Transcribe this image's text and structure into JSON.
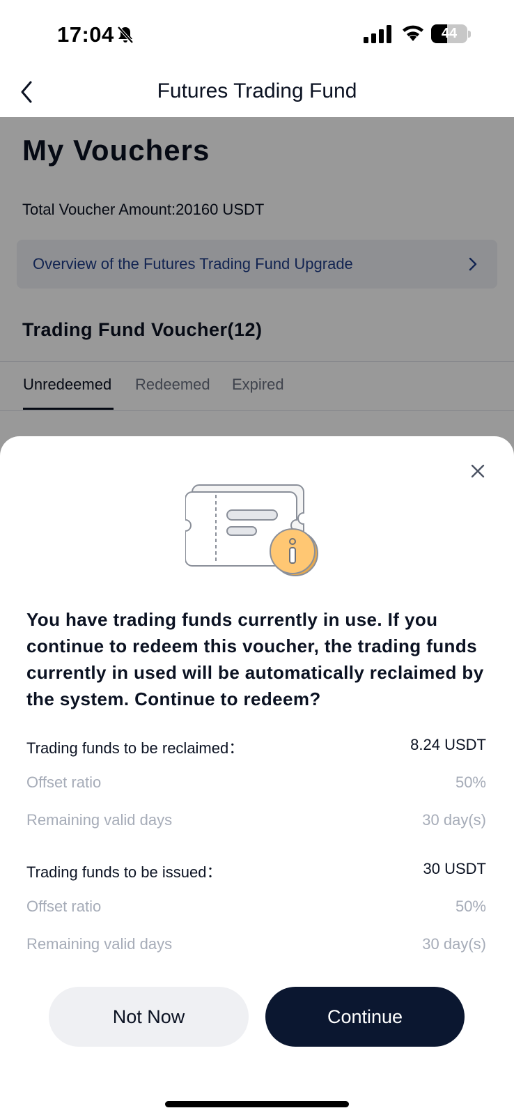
{
  "status_bar": {
    "time": "17:04",
    "battery_level": "44",
    "battery_fraction": 0.44
  },
  "nav": {
    "title": "Futures Trading Fund",
    "back_icon": "chevron-left-icon"
  },
  "page": {
    "title": "My Vouchers",
    "total_amount": "Total Voucher Amount:20160 USDT",
    "overview_link": "Overview of the Futures Trading Fund Upgrade",
    "section_title": "Trading Fund Voucher(12)",
    "tabs": [
      {
        "label": "Unredeemed",
        "active": true
      },
      {
        "label": "Redeemed",
        "active": false
      },
      {
        "label": "Expired",
        "active": false
      }
    ]
  },
  "sheet": {
    "illustration": "voucher-info-icon",
    "message": "You have trading funds currently in use. If you continue to redeem this voucher, the trading funds currently in used will be automatically reclaimed by the system. Continue to redeem?",
    "reclaimed": {
      "label": "Trading funds to be reclaimed：",
      "value": "8.24 USDT",
      "offset_label": "Offset ratio",
      "offset_value": "50%",
      "days_label": "Remaining valid days",
      "days_value": "30 day(s)"
    },
    "issued": {
      "label": "Trading funds to be issued：",
      "value": "30 USDT",
      "offset_label": "Offset ratio",
      "offset_value": "50%",
      "days_label": "Remaining valid days",
      "days_value": "30 day(s)"
    },
    "buttons": {
      "not_now": "Not Now",
      "continue": "Continue"
    }
  },
  "colors": {
    "primary": "#0b1730",
    "link": "#1f3c88",
    "muted": "#a6acb8",
    "accent_coin": "#ffc773"
  }
}
